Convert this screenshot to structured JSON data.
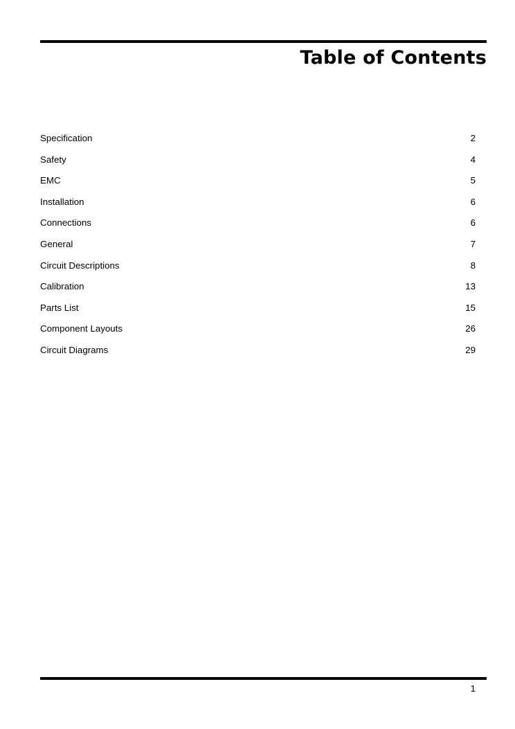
{
  "document": {
    "title": "Table of Contents"
  },
  "toc": {
    "entries": [
      {
        "label": "Specification",
        "page": "2"
      },
      {
        "label": "Safety",
        "page": "4"
      },
      {
        "label": "EMC",
        "page": "5"
      },
      {
        "label": "Installation",
        "page": "6"
      },
      {
        "label": "Connections",
        "page": "6"
      },
      {
        "label": "General",
        "page": "7"
      },
      {
        "label": "Circuit Descriptions",
        "page": "8"
      },
      {
        "label": "Calibration",
        "page": "13"
      },
      {
        "label": "Parts List",
        "page": "15"
      },
      {
        "label": "Component Layouts",
        "page": "26"
      },
      {
        "label": "Circuit Diagrams",
        "page": "29"
      }
    ]
  },
  "footer": {
    "page_number": "1"
  },
  "colors": {
    "text": "#000000",
    "rule": "#000000",
    "background": "#ffffff"
  }
}
